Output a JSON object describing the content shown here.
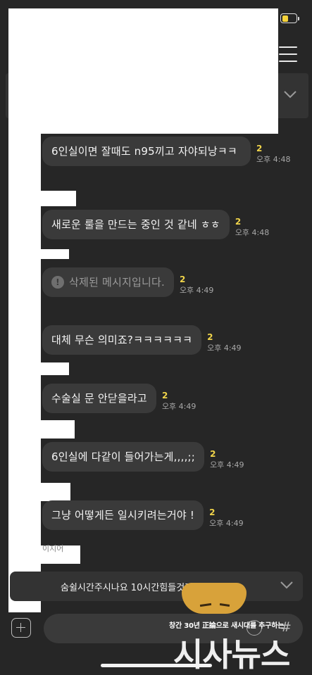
{
  "header": {
    "battery_level": 0.45,
    "menu_icon": "hamburger-menu-icon",
    "notice_chevron_icon": "chevron-down-icon"
  },
  "messages": [
    {
      "text": "6인실이면 잘때도 n95끼고 자야되낭ㅋㅋ",
      "count": "2",
      "time": "오후 4:48"
    },
    {
      "text": "새로운 룰을 만드는 중인 것 같네 ㅎㅎ",
      "count": "2",
      "time": "오후 4:48"
    },
    {
      "text": "삭제된 메시지입니다.",
      "count": "2",
      "time": "오후 4:49",
      "deleted": true
    },
    {
      "text": "대체 무슨 의미죠?ㅋㅋㅋㅋㅋㅋ",
      "count": "2",
      "time": "오후 4:49"
    },
    {
      "text": "수술실 문 안닫을라고",
      "count": "2",
      "time": "오후 4:49"
    },
    {
      "text": "6인실에 다같이 들어가는게,,,,;;",
      "count": "2",
      "time": "오후 4:49"
    },
    {
      "text": "그냥 어떻게든 일시키려는거야 !",
      "count": "2",
      "time": "오후 4:49"
    }
  ],
  "name_stub": "이지어",
  "preview": {
    "text": "숨쉴시간주시나요 10시간힘들것같은데",
    "chevron_icon": "chevron-down-icon"
  },
  "composer": {
    "plus_icon": "plus-icon",
    "emoji_icon": "emoji-icon",
    "hash_icon": "#"
  },
  "watermark": {
    "caption": "창간 30년 正論으로 새시대를 추구하는",
    "logo": "시사뉴스"
  }
}
